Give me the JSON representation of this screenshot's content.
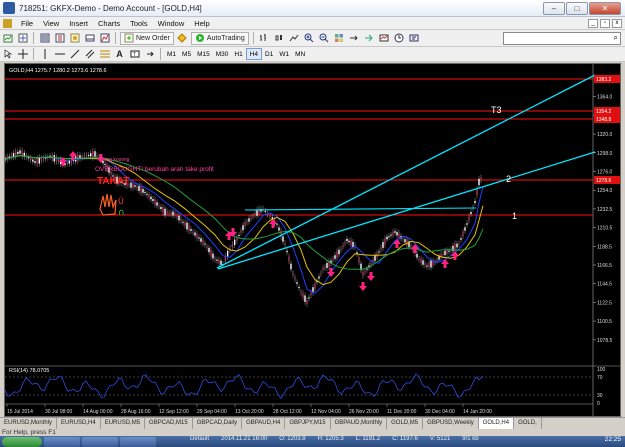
{
  "window": {
    "title": "718251: GKFX-Demo - Demo Account - [GOLD,H4]"
  },
  "menu": [
    "File",
    "View",
    "Insert",
    "Charts",
    "Tools",
    "Window",
    "Help"
  ],
  "toolbar": {
    "new_order": "New Order",
    "autotrading": "AutoTrading",
    "timeframes": [
      "M1",
      "M5",
      "M15",
      "M30",
      "H1",
      "H4",
      "D1",
      "W1",
      "MN"
    ],
    "active_timeframe": "H4",
    "search_placeholder": ""
  },
  "chart": {
    "header": "GOLD,H4  1275.7 1280.2 1273.6 1278.6",
    "background": "#000000",
    "price_ticks": [
      "1386.0",
      "1364.0",
      "1342.0",
      "1320.0",
      "1298.0",
      "1276.0",
      "1254.0",
      "1232.5",
      "1210.5",
      "1188.5",
      "1166.5",
      "1144.5",
      "1122.5",
      "1100.5",
      "1078.5"
    ],
    "price_tags": [
      "1383.2",
      "1354.2",
      "1348.8",
      "1278.6"
    ],
    "date_ticks": [
      "15 Jul 2014",
      "30 Jul 08:00",
      "14 Aug 00:00",
      "28 Aug 16:00",
      "12 Sep 12:00",
      "29 Sep 04:00",
      "13 Oct 20:00",
      "28 Oct 12:00",
      "12 Nov 04:00",
      "26 Nov 20:00",
      "11 Dec 20:00",
      "30 Dec 04:00",
      "14 Jan 20:00"
    ],
    "annotations": {
      "t3": "T3",
      "two": "2",
      "one": "1",
      "line_a": "Uang kosong",
      "line_b": "OVERBOUGHT! berubah arah take profit",
      "line_c": "TAKAT"
    },
    "rsi_header": "RSI(14) 78.0705",
    "rsi_ticks": [
      "100",
      "70",
      "30",
      "0"
    ],
    "colors": {
      "trendline": "#00e5ff",
      "hline": "#ff1010",
      "bull": "#ff2080",
      "rsi": "#3355ff",
      "ma_fast": "#1e40ff",
      "ma_mid": "#e6c300",
      "ma_slow": "#20a040"
    }
  },
  "tabs": [
    "EURUSD,Monthly",
    "EURUSD,H4",
    "EURUSD,M5",
    "GBPCAD,M15",
    "GBPCAD,Daily",
    "GBPAUD,H4",
    "GBPJPY,M15",
    "GBPAUD,Monthly",
    "GOLD,M5",
    "GBPUSD,Weekly",
    "GOLD,H4",
    "GOLD,"
  ],
  "active_tab": "GOLD,H4",
  "status": {
    "help": "For Help, press F1",
    "profile": "Default",
    "datetime": "2014.11.21 16:00",
    "open": "O: 1203.8",
    "high": "H: 1205.3",
    "low": "L: 1191.2",
    "close": "C: 1197.6",
    "volume": "V: 5121",
    "traffic": "9/1 kb",
    "clock": "22:25"
  }
}
